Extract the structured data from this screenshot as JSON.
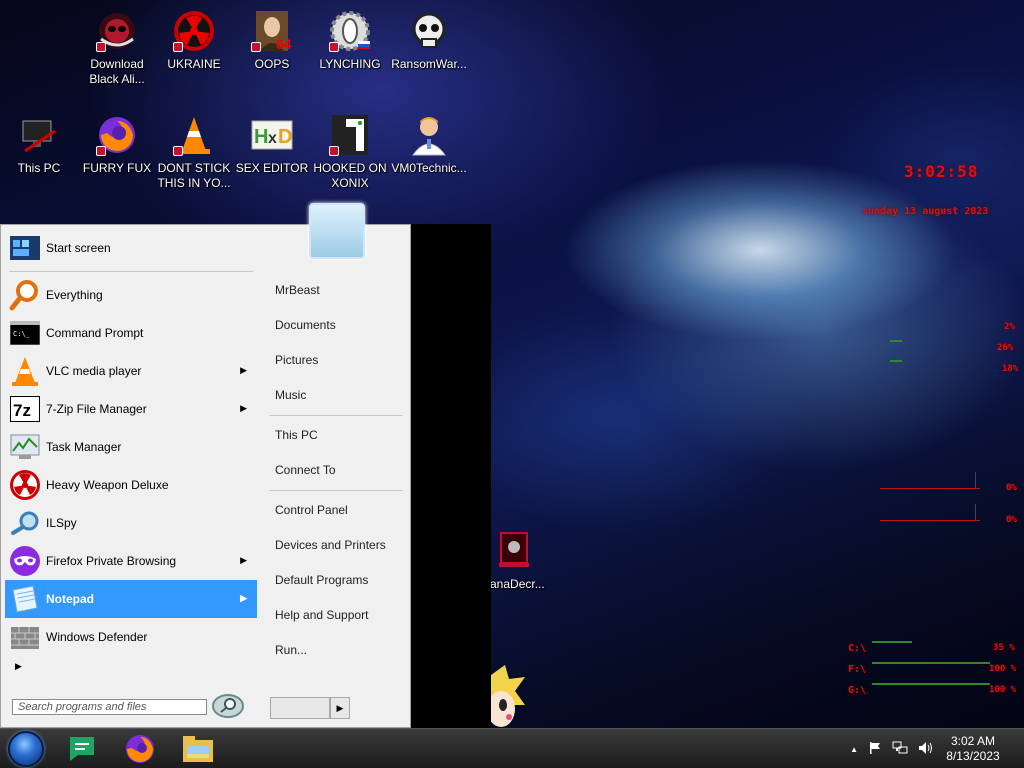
{
  "desktop": {
    "row1": [
      {
        "label": "Download Black Ali...",
        "icon": "alien-head-icon"
      },
      {
        "label": "UKRAINE",
        "icon": "radiation-icon"
      },
      {
        "label": "OOPS",
        "icon": "portrait-icon"
      },
      {
        "label": "LYNCHING",
        "icon": "gear-badge-icon"
      },
      {
        "label": "RansomWar...",
        "icon": "skull-icon"
      }
    ],
    "row2": [
      {
        "label": "This PC",
        "icon": "computer-icon"
      },
      {
        "label": "FURRY FUX",
        "icon": "firefox-icon"
      },
      {
        "label": "DONT STICK THIS IN YO...",
        "icon": "traffic-cone-icon"
      },
      {
        "label": "SEX EDITOR",
        "icon": "hex-editor-icon"
      },
      {
        "label": "HOOKED ON XONIX",
        "icon": "xonix-icon"
      },
      {
        "label": "VM0Technic...",
        "icon": "doctor-icon"
      }
    ],
    "extra_icon": {
      "label": "anaDecr...",
      "icon": "wanadecryptor-icon"
    }
  },
  "widgets": {
    "time": "3:02:58",
    "date": "sunday 13 august 2023",
    "cpu": [
      "2%",
      "26%",
      "18%"
    ],
    "net": [
      "0%",
      "0%"
    ],
    "drives": [
      {
        "letter": "C:\\",
        "value": "35 %",
        "fill": 0.15
      },
      {
        "letter": "F:\\",
        "value": "100 %",
        "fill": 1.0
      },
      {
        "letter": "G:\\",
        "value": "100 %",
        "fill": 1.0
      }
    ]
  },
  "start_menu": {
    "pinned": [
      {
        "label": "Start screen",
        "icon": "start-screen-icon"
      }
    ],
    "programs": [
      {
        "label": "Everything",
        "icon": "magnifier-icon",
        "arrow": false
      },
      {
        "label": "Command Prompt",
        "icon": "cmd-icon",
        "arrow": false
      },
      {
        "label": "VLC media player",
        "icon": "vlc-icon",
        "arrow": true
      },
      {
        "label": "7-Zip File Manager",
        "icon": "7zip-icon",
        "arrow": true
      },
      {
        "label": "Task Manager",
        "icon": "task-manager-icon",
        "arrow": false
      },
      {
        "label": "Heavy Weapon Deluxe",
        "icon": "radiation-icon",
        "arrow": false
      },
      {
        "label": "ILSpy",
        "icon": "ilspy-icon",
        "arrow": false
      },
      {
        "label": "Firefox Private Browsing",
        "icon": "private-mask-icon",
        "arrow": true
      },
      {
        "label": "Notepad",
        "icon": "notepad-icon",
        "arrow": true,
        "selected": true
      },
      {
        "label": "Windows Defender",
        "icon": "defender-wall-icon",
        "arrow": false
      }
    ],
    "right_links_1": [
      "MrBeast",
      "Documents",
      "Pictures",
      "Music"
    ],
    "right_links_2": [
      "This PC",
      "Connect To"
    ],
    "right_links_3": [
      "Control Panel",
      "Devices and Printers",
      "Default Programs",
      "Help and Support",
      "Run..."
    ],
    "search_placeholder": "Search programs and files"
  },
  "taskbar": {
    "apps": [
      "google-chat-icon",
      "firefox-icon",
      "file-explorer-icon"
    ],
    "clock_time": "3:02 AM",
    "clock_date": "8/13/2023"
  }
}
